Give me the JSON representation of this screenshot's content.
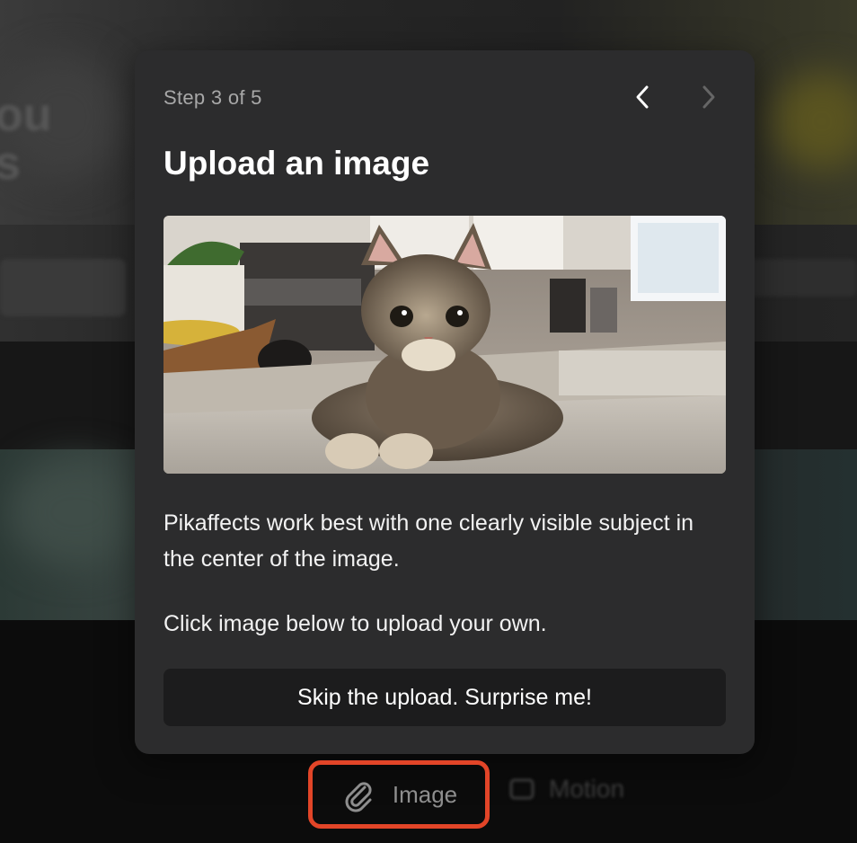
{
  "dialog": {
    "step_label": "Step 3 of 5",
    "prev_icon": "chevron-left-icon",
    "next_icon": "chevron-right-icon",
    "title": "Upload an image",
    "image_subject": "tabby kitten lying on a kitchen counter",
    "description": "Pikaffects work best with one clearly visible subject in the center of the image.",
    "instruction": "Click image below to upload your own.",
    "skip_label": "Skip the upload. Surprise me!"
  },
  "toolbar": {
    "image_label": "Image",
    "image_icon": "paperclip-icon",
    "motion_label": "Motion",
    "highlight_color": "#e24528"
  },
  "colors": {
    "dialog_bg": "#2c2c2d",
    "button_bg": "#1c1c1d",
    "muted_text": "#a8a8a8"
  }
}
